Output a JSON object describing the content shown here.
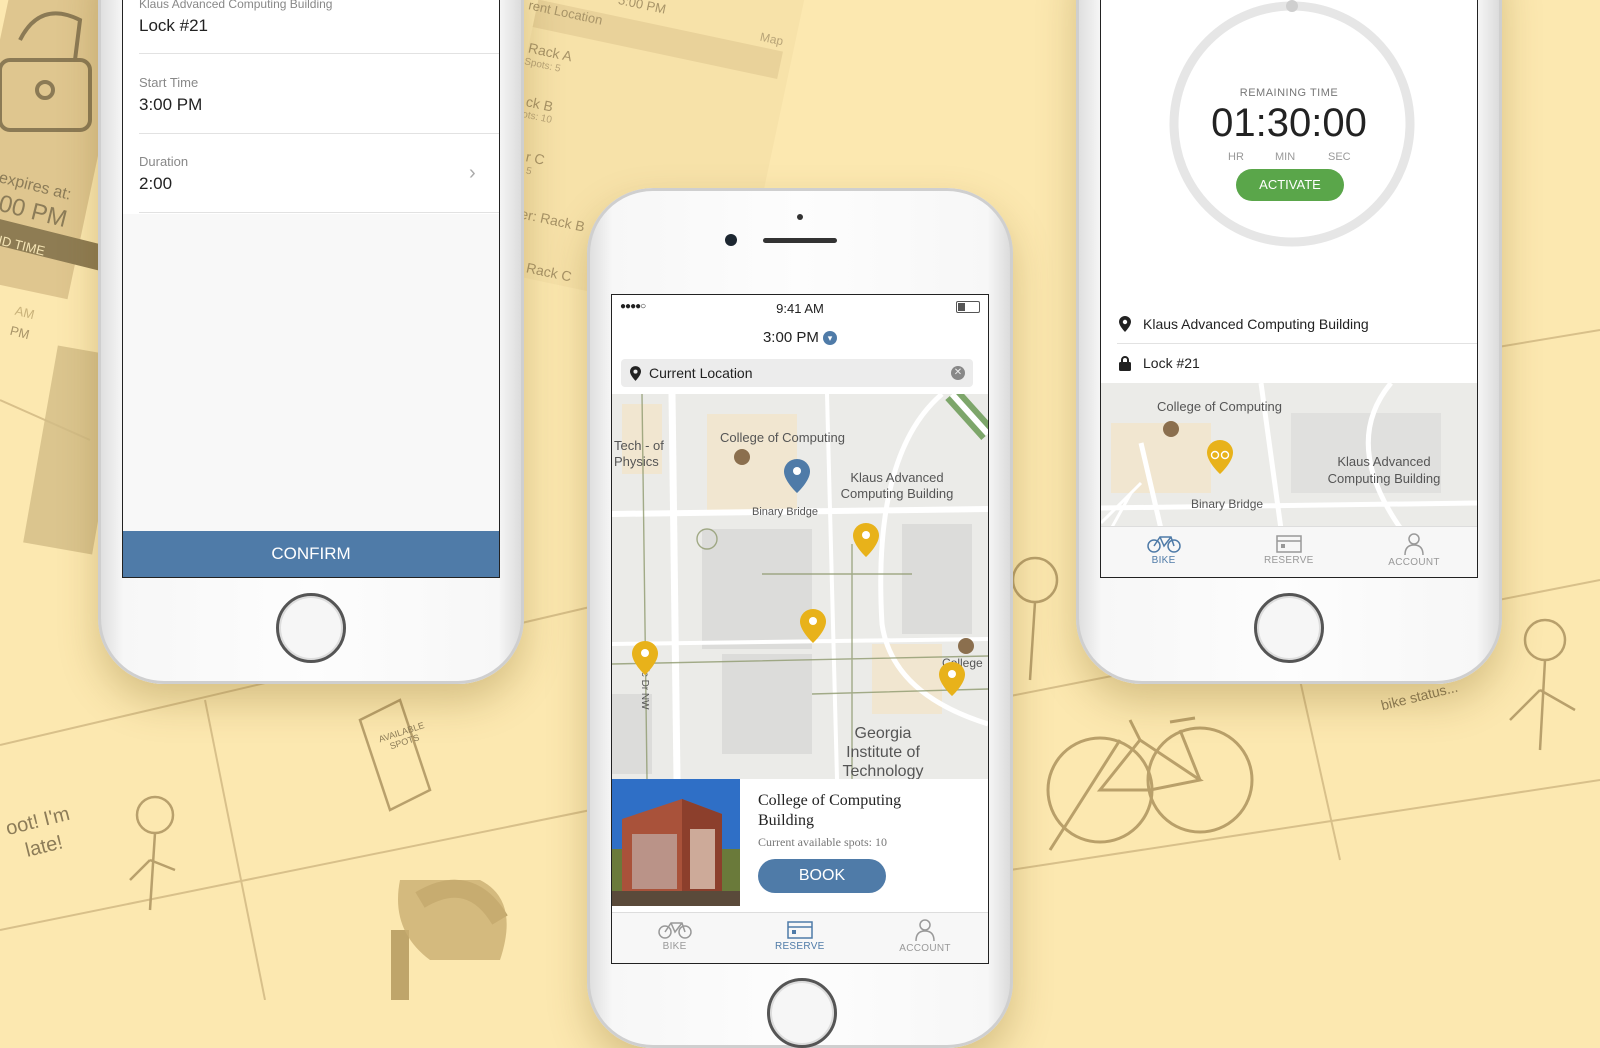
{
  "left_phone": {
    "building_label": "Klaus Advanced Computing Building",
    "lock_value": "Lock #21",
    "start_time_label": "Start Time",
    "start_time_value": "3:00 PM",
    "duration_label": "Duration",
    "duration_value": "2:00",
    "confirm_label": "CONFIRM"
  },
  "center_phone": {
    "status_time": "9:41 AM",
    "selected_time": "3:00 PM",
    "search_value": "Current Location",
    "map_labels": {
      "college": "College of Computing",
      "klaus": "Klaus Advanced Computing Building",
      "binary_bridge": "Binary Bridge",
      "tech_physics": "Tech - of Physics",
      "atlantic": "Atlantic Dr NW",
      "college_partial": "College",
      "georgia_tech": "Georgia Institute of Technology"
    },
    "card": {
      "title": "College of Computing Building",
      "subtitle": "Current available spots: 10",
      "book_label": "BOOK"
    },
    "tabs": [
      "BIKE",
      "RESERVE",
      "ACCOUNT"
    ],
    "active_tab": "RESERVE"
  },
  "right_phone": {
    "remaining_label": "REMAINING TIME",
    "timer": "01:30:00",
    "units": [
      "HR",
      "MIN",
      "SEC"
    ],
    "activate_label": "ACTIVATE",
    "location": "Klaus Advanced Computing Building",
    "lock": "Lock #21",
    "map_labels": {
      "college": "College of Computing",
      "klaus": "Klaus Advanced Computing Building",
      "binary_bridge": "Binary Bridge"
    },
    "tabs": [
      "BIKE",
      "RESERVE",
      "ACCOUNT"
    ],
    "active_tab": "BIKE"
  },
  "background_sketch": {
    "expires": "expires at:",
    "time": "00 PM",
    "time_label": "ID TIME",
    "am": "AM",
    "pm": "PM",
    "late_bubble": "oot! I'm late!",
    "status_bubble": "bike status...",
    "available_card": "AVAILABLE SPOTS",
    "current_location": "rent Location",
    "time_partial": "- 5:00 PM",
    "map_partial": "Map",
    "rack_a": "Rack A",
    "rack_a_spots": "Spots: 5",
    "rack_b": "ck B",
    "rack_b_spots": "ots: 10",
    "rack_c": "r C",
    "rack_c_spots": "5",
    "rack_b2": "er: Rack B",
    "rack_c2": "Rack C"
  },
  "colors": {
    "background": "#fce8b0",
    "primary_blue": "#4f7ba8",
    "pin_yellow": "#e8b21a",
    "pin_blue": "#4f7ba8",
    "activate_green": "#5aa64a"
  }
}
